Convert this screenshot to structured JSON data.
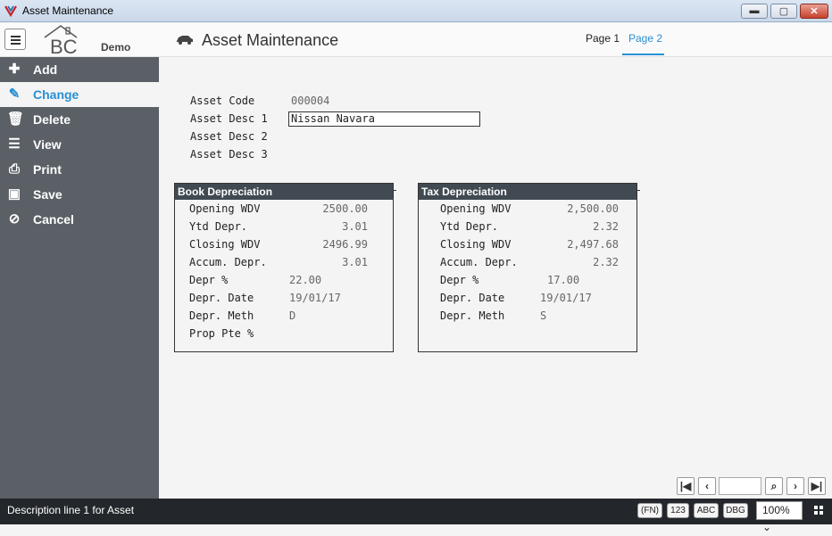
{
  "window": {
    "title": "Asset Maintenance"
  },
  "header": {
    "logo_text": "BC",
    "logo_demo": "Demo",
    "page_title": "Asset Maintenance",
    "tabs": [
      {
        "label": "Page 1",
        "active": false
      },
      {
        "label": "Page 2",
        "active": true
      }
    ]
  },
  "sidebar": {
    "items": [
      {
        "label": "Add",
        "icon": "plus-icon"
      },
      {
        "label": "Change",
        "icon": "pencil-icon",
        "active": true
      },
      {
        "label": "Delete",
        "icon": "trash-icon"
      },
      {
        "label": "View",
        "icon": "list-icon"
      },
      {
        "label": "Print",
        "icon": "printer-icon"
      },
      {
        "label": "Save",
        "icon": "floppy-icon"
      },
      {
        "label": "Cancel",
        "icon": "cancel-icon"
      }
    ]
  },
  "form": {
    "asset_code_label": "Asset Code",
    "asset_code_value": "000004",
    "asset_desc1_label": "Asset Desc 1",
    "asset_desc1_value": "Nissan Navara",
    "asset_desc2_label": "Asset Desc 2",
    "asset_desc3_label": "Asset Desc 3"
  },
  "book": {
    "title": "Book Depreciation",
    "rows": [
      {
        "label": "Opening WDV",
        "value": "2500.00"
      },
      {
        "label": "Ytd Depr.",
        "value": "3.01"
      },
      {
        "label": "Closing WDV",
        "value": "2496.99"
      },
      {
        "label": "Accum. Depr.",
        "value": "3.01"
      },
      {
        "label": "Depr %",
        "value": "22.00"
      },
      {
        "label": "Depr. Date",
        "value": "19/01/17"
      },
      {
        "label": "Depr. Meth",
        "value": "D"
      },
      {
        "label": "Prop Pte %",
        "value": ""
      }
    ]
  },
  "tax": {
    "title": "Tax Depreciation",
    "rows": [
      {
        "label": "Opening WDV",
        "value": "2,500.00"
      },
      {
        "label": "Ytd Depr.",
        "value": "2.32"
      },
      {
        "label": "Closing WDV",
        "value": "2,497.68"
      },
      {
        "label": "Accum. Depr.",
        "value": "2.32"
      },
      {
        "label": "Depr %",
        "value": "17.00"
      },
      {
        "label": "Depr. Date",
        "value": "19/01/17"
      },
      {
        "label": "Depr. Meth",
        "value": "S"
      }
    ]
  },
  "pager": {
    "first": "first-icon",
    "prev": "prev-icon",
    "search": "search-icon",
    "next": "next-icon",
    "last": "last-icon"
  },
  "status": {
    "message": "Description line 1 for Asset",
    "badges": [
      "(FN)",
      "123",
      "ABC",
      "DBG"
    ],
    "zoom": "100%"
  },
  "colors": {
    "accent": "#2a8fd4",
    "sidebar": "#5a6066",
    "statusbar": "#23272b",
    "panel_header": "#414a52"
  }
}
